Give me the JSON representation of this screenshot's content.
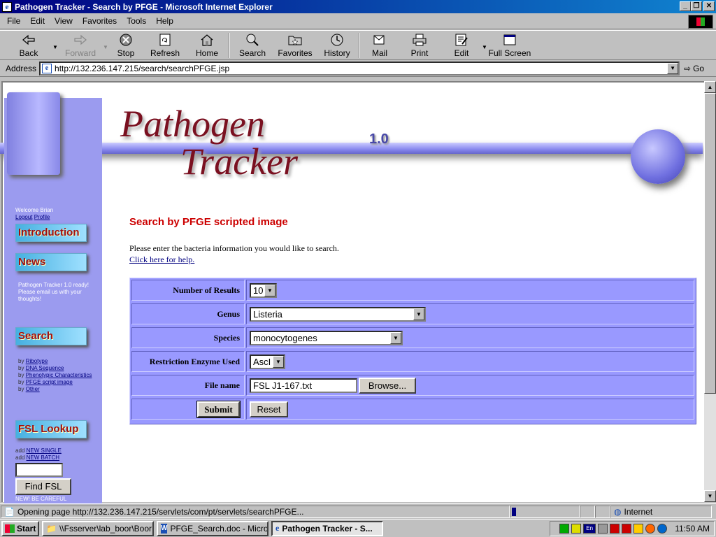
{
  "window": {
    "title": "Pathogen Tracker - Search by PFGE - Microsoft Internet Explorer"
  },
  "menu": [
    "File",
    "Edit",
    "View",
    "Favorites",
    "Tools",
    "Help"
  ],
  "toolbar": {
    "back": "Back",
    "forward": "Forward",
    "stop": "Stop",
    "refresh": "Refresh",
    "home": "Home",
    "search": "Search",
    "favorites": "Favorites",
    "history": "History",
    "mail": "Mail",
    "print": "Print",
    "edit": "Edit",
    "fullscreen": "Full Screen"
  },
  "address": {
    "label": "Address",
    "url": "http://132.236.147.215/search/searchPFGE.jsp",
    "go": "Go"
  },
  "logo": {
    "line1": "Pathogen",
    "line2": "Tracker",
    "version": "1.0"
  },
  "sidebar": {
    "welcome": "Welcome Brian",
    "logout": "Logout",
    "profile": "Profile",
    "intro": "Introduction",
    "news": "News",
    "news_text": "Pathogen Tracker 1.0 ready! Please email us with your thoughts!",
    "search": "Search",
    "search_links": [
      {
        "prefix": "by",
        "label": "Ribotype"
      },
      {
        "prefix": "by",
        "label": "DNA Sequence"
      },
      {
        "prefix": "by",
        "label": "Phenotypic Characteristics"
      },
      {
        "prefix": "by",
        "label": "PFGE script image"
      },
      {
        "prefix": "by",
        "label": "Other"
      }
    ],
    "fsl": "FSL Lookup",
    "fsl_add": [
      {
        "prefix": "add",
        "label": "NEW SINGLE"
      },
      {
        "prefix": "add",
        "label": "NEW BATCH"
      }
    ],
    "find_fsl": "Find FSL",
    "warning": "NEW! BE CAREFUL"
  },
  "main": {
    "title": "Search by PFGE scripted image",
    "intro": "Please enter the bacteria information you would like to search.",
    "help": "Click here for help."
  },
  "form": {
    "results_label": "Number of Results",
    "results_value": "10",
    "genus_label": "Genus",
    "genus_value": "Listeria",
    "species_label": "Species",
    "species_value": "monocytogenes",
    "enzyme_label": "Restriction Enzyme Used",
    "enzyme_value": "AscI",
    "file_label": "File name",
    "file_value": "FSL J1-167.txt",
    "browse": "Browse...",
    "submit": "Submit",
    "reset": "Reset"
  },
  "status": {
    "text": "Opening page http://132.236.147.215/servlets/com/pt/servlets/searchPFGE...",
    "zone": "Internet"
  },
  "taskbar": {
    "start": "Start",
    "items": [
      "\\\\Fsserver\\lab_boor\\Boor ...",
      "PFGE_Search.doc - Micro...",
      "Pathogen Tracker - S..."
    ],
    "lang": "En",
    "time": "11:50 AM"
  },
  "colors": {
    "title_red": "#cc0000",
    "sidebar": "#9b9bef",
    "form_bg": "#9999ff",
    "logo": "#7a1020"
  }
}
